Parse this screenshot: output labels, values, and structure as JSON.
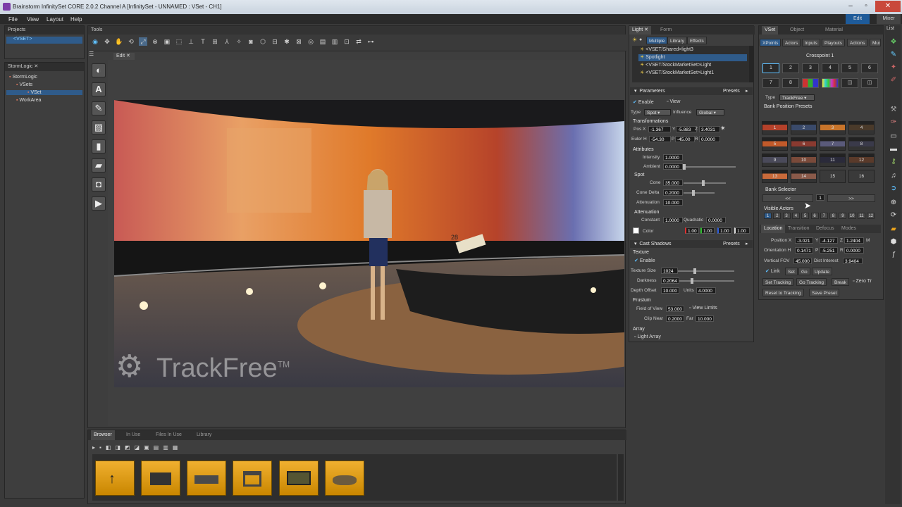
{
  "window": {
    "title": "Brainstorm InfinitySet CORE 2.0.2  Channel A [InfinitySet - UNNAMED : VSet - CH1]"
  },
  "menu": [
    "File",
    "View",
    "Layout",
    "Help"
  ],
  "modes": {
    "edit": "Edit",
    "mixer": "Mixer"
  },
  "right_strip_tab": "List",
  "projects_panel": {
    "tab": "Projects",
    "item": "<VSET>"
  },
  "storm_panel": {
    "tab": "StormLogic",
    "items": [
      "StormLogic",
      "VSets",
      "VSet",
      "WorkArea"
    ]
  },
  "tools_panel": {
    "tab": "Tools",
    "edit_tab": "Edit"
  },
  "viewport": {
    "watermark": "TrackFree",
    "tm": "TM",
    "ticker": "28"
  },
  "browser": {
    "tabs": [
      "Browser",
      "In Use",
      "Files In Use",
      "Library"
    ]
  },
  "light_panel": {
    "tabs": [
      "Light",
      "Form"
    ],
    "subtabs": [
      "Multiple",
      "Library",
      "Effects"
    ],
    "lights": [
      "<VSET/Shared>light3",
      "Spotlight",
      "<VSET/StockMarketSet>Light",
      "<VSET/StockMarketSet>Light1"
    ],
    "parameters": "Parameters",
    "presets": "Presets",
    "enable": "Enable",
    "view": "View",
    "type_label": "Type",
    "type_value": "Spot",
    "influence_label": "Influence",
    "influence_value": "Global",
    "transformations": "Transformations",
    "pos_label": "Pos X",
    "pos_x": "-1.367",
    "pos_y_label": "Y",
    "pos_y": "-5.883",
    "pos_z_label": "Z",
    "pos_z": "3.4031",
    "euler_label": "Euler H",
    "euler_h": "-54.30",
    "euler_p_label": "P",
    "euler_p": "-45.00",
    "euler_r_label": "R",
    "euler_r": "0.0000",
    "attributes": "Attributes",
    "intensity_label": "Intensity",
    "intensity": "1.0000",
    "ambient_label": "Ambient",
    "ambient": "0.0000",
    "spot": "Spot",
    "cone_label": "Cone",
    "cone": "35.000",
    "cone_delta_label": "Cone Delta",
    "cone_delta": "0.2000",
    "attenuation_label": "Attenuation",
    "attenuation": "10.000",
    "attenuation_hdr": "Attenuation",
    "constant_label": "Constant",
    "constant": "1.0000",
    "quadratic_label": "Quadratic",
    "quadratic": "0.0000",
    "color_label": "Color",
    "color_r": "1.00",
    "color_g": "1.00",
    "color_b": "1.00",
    "color_a": "1.00",
    "cast_shadows": "Cast Shadows",
    "texture": "Texture",
    "texture_size_label": "Texture Size",
    "texture_size": "1024",
    "darkness_label": "Darkness",
    "darkness": "0.2064",
    "depth_offset_label": "Depth Offset",
    "depth_offset": "10.000",
    "units_label": "Units",
    "units": "4.0000",
    "frustum": "Frustum",
    "fov_label": "Field of View",
    "fov": "53.000",
    "view_limits": "View Limits",
    "clip_near_label": "Clip Near",
    "clip_near": "0.2000",
    "far_label": "Far",
    "far": "10.000",
    "array": "Array",
    "light_array": "Light Array"
  },
  "vset_panel": {
    "tabs": [
      "VSet",
      "Object",
      "Material"
    ],
    "subtabs": [
      "XPoints",
      "Actors",
      "Inputs",
      "Playouts",
      "Actions",
      "Music"
    ],
    "crosspoint": "Crosspoint 1",
    "cp_row1": [
      "1",
      "2",
      "3",
      "4",
      "5",
      "6"
    ],
    "cp_row2": [
      "7",
      "8",
      "",
      "",
      "",
      ""
    ],
    "type_label": "Type",
    "type_value": "TrackFree",
    "bank_presets": "Bank Position Presets",
    "preset_labels": [
      "1",
      "2",
      "3",
      "4",
      "5",
      "6",
      "7",
      "8",
      "9",
      "10",
      "11",
      "12",
      "13",
      "14",
      "15",
      "16"
    ],
    "bank_selector": "Bank Selector",
    "bank_left": "<<",
    "bank_value": "1",
    "bank_right": ">>",
    "visible_actors": "Visible Actors",
    "actors": [
      "1",
      "2",
      "3",
      "4",
      "5",
      "6",
      "7",
      "8",
      "9",
      "10",
      "11",
      "12"
    ],
    "loc_tabs": [
      "Location",
      "Transition",
      "Defocus",
      "Modes"
    ],
    "position_label": "Position X",
    "pos_x": "-3.021",
    "pos_y_label": "Y",
    "pos_y": "-4.127",
    "pos_z_label": "Z",
    "pos_z": "1.2404",
    "pos_m": "M",
    "orientation_label": "Orientation H",
    "orient_h": "0.1471",
    "orient_p_label": "P",
    "orient_p": "-5.251",
    "orient_r_label": "R",
    "orient_r": "0.0000",
    "vfov_label": "Vertical FOV",
    "vfov": "45.000",
    "dist_label": "Dist Interest",
    "dist": "3.9404",
    "link": "Link",
    "set": "Set",
    "go": "Go",
    "update": "Update",
    "set_tracking": "Set Tracking",
    "go_tracking": "Go Tracking",
    "break": "Break",
    "zero_tr": "Zero Tr",
    "reset_to_tracking": "Reset to Tracking",
    "save_preset": "Save Preset"
  },
  "colors": {
    "selection": "#2f5b8a",
    "accent": "#5fc0ff",
    "folder": "#e8a21c"
  }
}
